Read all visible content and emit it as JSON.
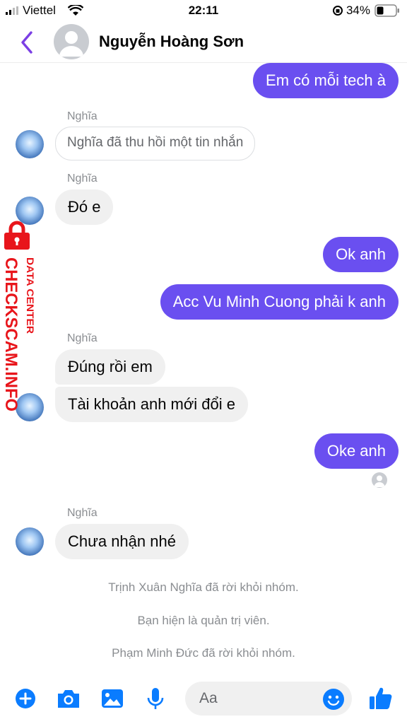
{
  "status_bar": {
    "carrier": "Viettel",
    "time": "22:11",
    "battery": "34%"
  },
  "header": {
    "contact_name": "Nguyễn Hoàng Sơn"
  },
  "messages": [
    {
      "text": "Em có mỗi tech à"
    },
    {
      "sender": "Nghĩa",
      "text": "Nghĩa đã thu hồi một tin nhắn"
    },
    {
      "sender": "Nghĩa",
      "text": "Đó e"
    },
    {
      "text": "Ok anh"
    },
    {
      "text": "Acc Vu Minh Cuong phải k anh"
    },
    {
      "sender": "Nghĩa",
      "text": "Đúng rồi em"
    },
    {
      "text": "Tài khoản  anh mới đổi e"
    },
    {
      "text": "Oke anh"
    },
    {
      "sender": "Nghĩa",
      "text": "Chưa nhận nhé"
    }
  ],
  "system_messages": [
    "Trịnh Xuân Nghĩa đã rời khỏi nhóm.",
    "Bạn hiện là quản trị viên.",
    "Phạm Minh Đức đã rời khỏi nhóm."
  ],
  "watermark": {
    "main": "CHECKSCAM.INFO",
    "sub": "DATA CENTER"
  },
  "composer": {
    "placeholder": "Aa"
  },
  "colors": {
    "accent": "#6a4ff0",
    "icon": "#0a7cff",
    "watermark": "#e8151b"
  }
}
